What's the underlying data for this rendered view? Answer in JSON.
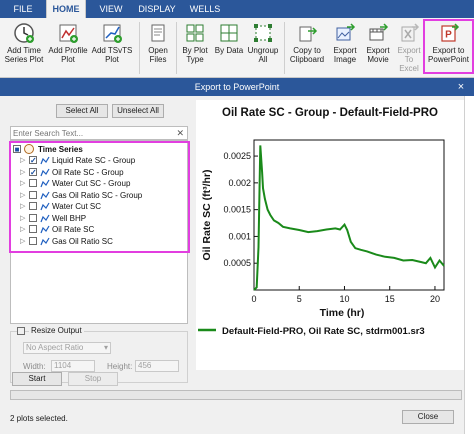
{
  "ribbon": {
    "tabs": [
      {
        "label": "FILE",
        "active": false
      },
      {
        "label": "HOME",
        "active": true
      },
      {
        "label": "VIEW",
        "active": false
      },
      {
        "label": "DISPLAY",
        "active": false
      },
      {
        "label": "WELLS",
        "active": false
      }
    ],
    "buttons": [
      {
        "label": "Add Time Series Plot",
        "icon": "add-time-series-plot-icon",
        "enabled": true
      },
      {
        "label": "Add Profile Plot",
        "icon": "add-profile-plot-icon",
        "enabled": true
      },
      {
        "label": "Add TSvTS Plot",
        "icon": "add-tsvts-plot-icon",
        "enabled": true
      },
      {
        "label": "Open Files",
        "icon": "open-files-icon",
        "enabled": true
      },
      {
        "label": "By Plot Type",
        "icon": "group-by-plot-type-icon",
        "enabled": true
      },
      {
        "label": "By Data",
        "icon": "group-by-data-icon",
        "enabled": true
      },
      {
        "label": "Ungroup All",
        "icon": "ungroup-all-icon",
        "enabled": true
      },
      {
        "label": "Copy to Clipboard",
        "icon": "copy-to-clipboard-icon",
        "enabled": true
      },
      {
        "label": "Export Image",
        "icon": "export-image-icon",
        "enabled": true
      },
      {
        "label": "Export Movie",
        "icon": "export-movie-icon",
        "enabled": true
      },
      {
        "label": "Export To Excel",
        "icon": "export-to-excel-icon",
        "enabled": false
      },
      {
        "label": "Export to PowerPoint",
        "icon": "export-to-powerpoint-icon",
        "enabled": true
      }
    ]
  },
  "dialog": {
    "title": "Export to PowerPoint",
    "close_glyph": "×",
    "select_all": "Select All",
    "unselect_all": "Unselect All",
    "search_placeholder": "Enter Search Text...",
    "search_clear_glyph": "✕",
    "tree": {
      "root_label": "Time Series",
      "root_checked": true,
      "items": [
        {
          "label": "Liquid Rate SC - Group",
          "checked": true
        },
        {
          "label": "Oil Rate SC - Group",
          "checked": true
        },
        {
          "label": "Water Cut SC - Group",
          "checked": false
        },
        {
          "label": "Gas Oil Ratio SC - Group",
          "checked": false
        },
        {
          "label": "Water Cut SC",
          "checked": false
        },
        {
          "label": "Well BHP",
          "checked": false
        },
        {
          "label": "Oil Rate SC",
          "checked": false
        },
        {
          "label": "Gas Oil Ratio SC",
          "checked": false
        }
      ]
    },
    "resize": {
      "label": "Resize Output",
      "checked": false,
      "aspect_ratio": "No Aspect Ratio",
      "width_label": "Width:",
      "width_value": "1104",
      "height_label": "Height:",
      "height_value": "456"
    },
    "start_label": "Start",
    "stop_label": "Stop",
    "status": "2 plots selected.",
    "close_label": "Close"
  },
  "chart_data": {
    "type": "line",
    "title": "Oil Rate SC - Group - Default-Field-PRO",
    "xlabel": "Time (hr)",
    "ylabel": "Oil Rate SC (ft³/hr)",
    "xlim": [
      0,
      21
    ],
    "ylim": [
      0,
      0.0028
    ],
    "x_ticks": [
      "0",
      "5",
      "10",
      "15",
      "20"
    ],
    "y_ticks": [
      "0.0005",
      "0.001",
      "0.0015",
      "0.002",
      "0.0025"
    ],
    "grid": false,
    "legend_position": "bottom",
    "series": [
      {
        "name": "Default-Field-PRO, Oil Rate SC, stdrm001.sr3",
        "color": "#1a8a1a",
        "x": [
          0.0,
          0.3,
          0.5,
          0.7,
          0.9,
          1.0,
          1.2,
          1.5,
          1.8,
          2.2,
          2.7,
          3.2,
          4.0,
          5.0,
          6.0,
          7.0,
          8.0,
          9.0,
          9.5,
          10.0,
          10.3,
          10.7,
          11.2,
          11.8,
          12.5,
          13.5,
          14.5,
          15.5,
          16.5,
          17.5,
          18.5,
          19.0,
          19.5,
          20.0,
          20.5,
          21.0
        ],
        "y": [
          0.0,
          5e-05,
          0.0008,
          0.0027,
          0.0022,
          0.0019,
          0.0017,
          0.0015,
          0.0014,
          0.0013,
          0.00125,
          0.00118,
          0.00115,
          0.00112,
          0.00108,
          0.0011,
          0.00113,
          0.00115,
          0.00113,
          0.00122,
          0.00112,
          0.0009,
          0.00078,
          0.00075,
          0.00072,
          0.00066,
          0.00062,
          0.0006,
          0.00055,
          0.00056,
          0.00052,
          0.0005,
          0.0006,
          0.00042,
          0.00055,
          0.00045
        ]
      }
    ]
  }
}
